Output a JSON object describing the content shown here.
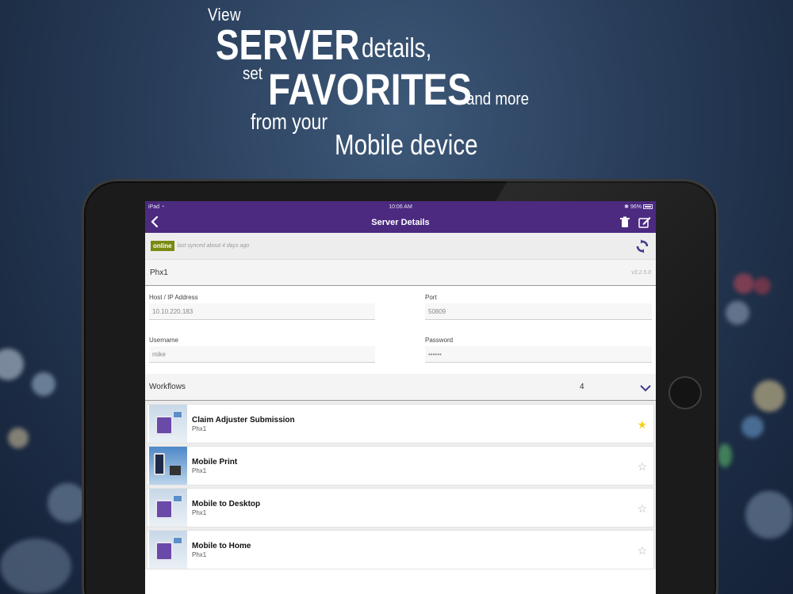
{
  "headline": {
    "view": "View",
    "server": "SERVER",
    "details": "details,",
    "set": "set",
    "favorites": "FAVORITES",
    "and_more": "and more",
    "from_your": "from your",
    "mobile_device": "Mobile device"
  },
  "status_bar": {
    "carrier": "iPad",
    "time": "10:06 AM",
    "battery": "96%"
  },
  "nav": {
    "title": "Server Details"
  },
  "sync": {
    "status": "online",
    "last_synced": "last synced about 4 days ago"
  },
  "server": {
    "name": "Phx1",
    "version": "v3.2.5.0"
  },
  "form": {
    "host_label": "Host / IP Address",
    "host_value": "10.10.220.183",
    "port_label": "Port",
    "port_value": "50809",
    "username_label": "Username",
    "username_value": "mike",
    "password_label": "Password",
    "password_value": "••••••"
  },
  "workflows": {
    "title": "Workflows",
    "count": "4",
    "items": [
      {
        "name": "Claim Adjuster Submission",
        "server": "Phx1",
        "favorite": true
      },
      {
        "name": "Mobile Print",
        "server": "Phx1",
        "favorite": false
      },
      {
        "name": "Mobile to Desktop",
        "server": "Phx1",
        "favorite": false
      },
      {
        "name": "Mobile to Home",
        "server": "Phx1",
        "favorite": false
      }
    ]
  },
  "colors": {
    "nav_purple": "#4b2a80",
    "online_badge": "#7a8a10",
    "star_on": "#f2d21b"
  }
}
